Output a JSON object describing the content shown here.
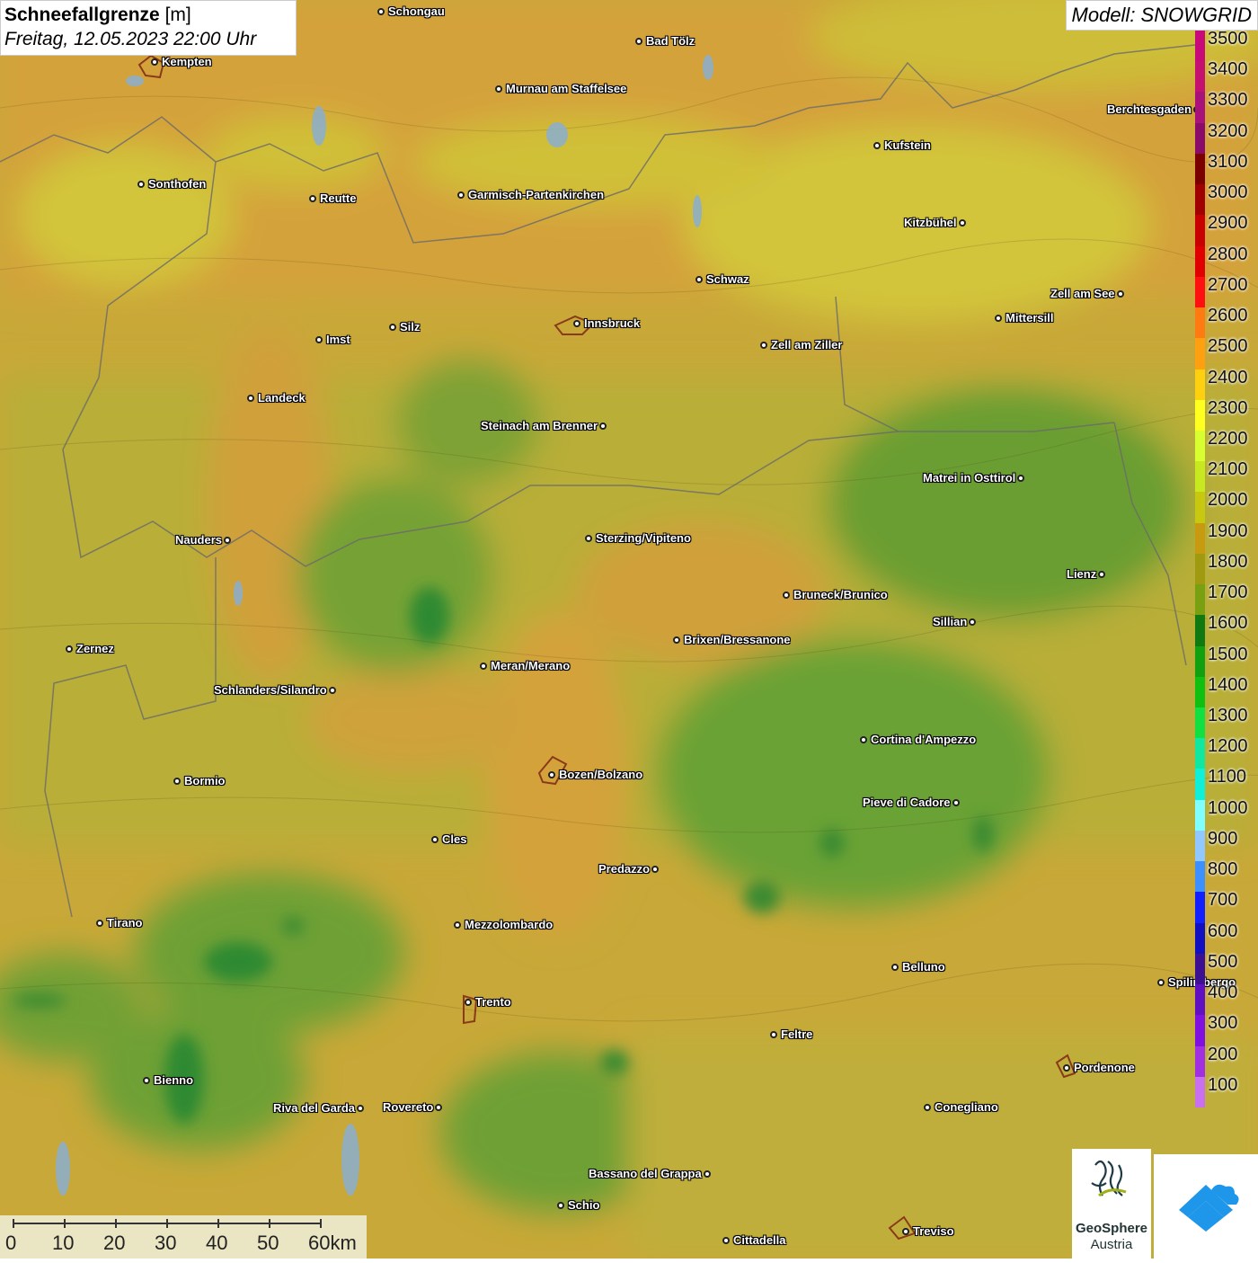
{
  "title": {
    "main": "Schneefallgrenze",
    "unit": "[m]",
    "datetime": "Freitag, 12.05.2023 22:00 Uhr"
  },
  "model": "Modell: SNOWGRID",
  "legend": {
    "ticks": [
      "3500",
      "3400",
      "3300",
      "3200",
      "3100",
      "3000",
      "2900",
      "2800",
      "2700",
      "2600",
      "2500",
      "2400",
      "2300",
      "2200",
      "2100",
      "2000",
      "1900",
      "1800",
      "1700",
      "1600",
      "1500",
      "1400",
      "1300",
      "1200",
      "1100",
      "1000",
      "900",
      "800",
      "700",
      "600",
      "500",
      "400",
      "300",
      "200",
      "100"
    ],
    "colors": [
      "#c80a78",
      "#c4106e",
      "#a8107a",
      "#8a0a6a",
      "#7a0000",
      "#a00000",
      "#c80000",
      "#e00000",
      "#ff1010",
      "#ff7a10",
      "#ffa010",
      "#ffd010",
      "#ffff20",
      "#d8ff30",
      "#c8e820",
      "#c8c810",
      "#c89a10",
      "#a09a10",
      "#78a010",
      "#107a10",
      "#10a010",
      "#10c010",
      "#10e040",
      "#10e8a0",
      "#10f0d8",
      "#80ffff",
      "#90c8ff",
      "#3c90ff",
      "#1020ff",
      "#1010c0",
      "#3c1090",
      "#6010c0",
      "#8010e0",
      "#a030e0",
      "#c870f0"
    ]
  },
  "cities": [
    {
      "name": "Schongau",
      "side": "r"
    },
    {
      "name": "Kempten",
      "side": "r"
    },
    {
      "name": "Bad Tölz",
      "side": "r"
    },
    {
      "name": "Murnau am Staffelsee",
      "side": "r"
    },
    {
      "name": "Berchtesgaden",
      "side": "l"
    },
    {
      "name": "Kufstein",
      "side": "r"
    },
    {
      "name": "Sonthofen",
      "side": "r"
    },
    {
      "name": "Reutte",
      "side": "r"
    },
    {
      "name": "Garmisch-Partenkirchen",
      "side": "r"
    },
    {
      "name": "Kitzbühel",
      "side": "l"
    },
    {
      "name": "Schwaz",
      "side": "r"
    },
    {
      "name": "Zell am See",
      "side": "l"
    },
    {
      "name": "Innsbruck",
      "side": "r"
    },
    {
      "name": "Silz",
      "side": "r"
    },
    {
      "name": "Imst",
      "side": "r"
    },
    {
      "name": "Mittersill",
      "side": "r"
    },
    {
      "name": "Zell am Ziller",
      "side": "r"
    },
    {
      "name": "Landeck",
      "side": "r"
    },
    {
      "name": "Steinach am Brenner",
      "side": "l"
    },
    {
      "name": "Matrei in Osttirol",
      "side": "l"
    },
    {
      "name": "Nauders",
      "side": "l"
    },
    {
      "name": "Sterzing/Vipiteno",
      "side": "r"
    },
    {
      "name": "Lienz",
      "side": "l"
    },
    {
      "name": "Bruneck/Brunico",
      "side": "r"
    },
    {
      "name": "Sillian",
      "side": "l"
    },
    {
      "name": "Zernez",
      "side": "r"
    },
    {
      "name": "Brixen/Bressanone",
      "side": "r"
    },
    {
      "name": "Meran/Merano",
      "side": "r"
    },
    {
      "name": "Schlanders/Silandro",
      "side": "l"
    },
    {
      "name": "Cortina d'Ampezzo",
      "side": "r"
    },
    {
      "name": "Bozen/Bolzano",
      "side": "r"
    },
    {
      "name": "Bormio",
      "side": "r"
    },
    {
      "name": "Pieve di Cadore",
      "side": "l"
    },
    {
      "name": "Cles",
      "side": "r"
    },
    {
      "name": "Predazzo",
      "side": "l"
    },
    {
      "name": "Tirano",
      "side": "r"
    },
    {
      "name": "Mezzolombardo",
      "side": "r"
    },
    {
      "name": "Belluno",
      "side": "r"
    },
    {
      "name": "Spilimbergo",
      "side": "r"
    },
    {
      "name": "Trento",
      "side": "r"
    },
    {
      "name": "Feltre",
      "side": "r"
    },
    {
      "name": "Pordenone",
      "side": "r"
    },
    {
      "name": "Bienno",
      "side": "r"
    },
    {
      "name": "Riva del Garda",
      "side": "l"
    },
    {
      "name": "Rovereto",
      "side": "l"
    },
    {
      "name": "Conegliano",
      "side": "r"
    },
    {
      "name": "Bassano del Grappa",
      "side": "l"
    },
    {
      "name": "Schio",
      "side": "r"
    },
    {
      "name": "Treviso",
      "side": "r"
    },
    {
      "name": "Cittadella",
      "side": "r"
    }
  ],
  "scalebar": {
    "labels": [
      "0",
      "10",
      "20",
      "30",
      "40",
      "50",
      "60km"
    ]
  },
  "logos": {
    "geosphere_line1": "GeoSphere",
    "geosphere_line2": "Austria"
  }
}
